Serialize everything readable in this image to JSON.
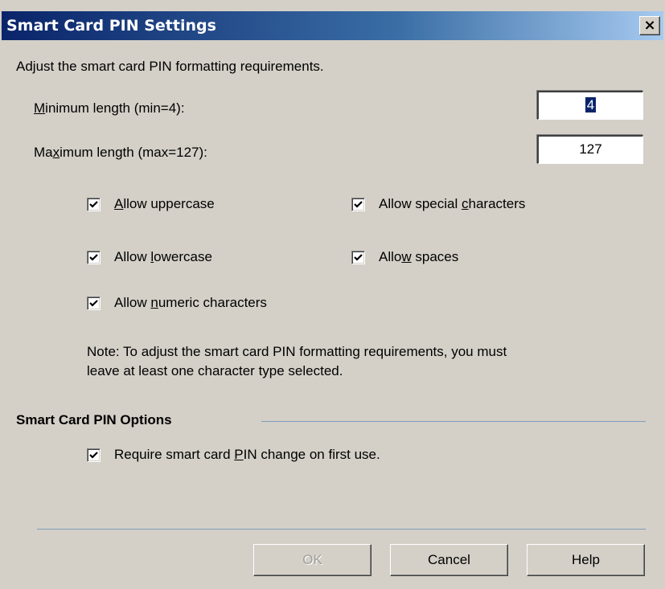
{
  "window": {
    "title": "Smart Card PIN Settings",
    "close_glyph": "×"
  },
  "intro_text": "Adjust the smart card PIN formatting requirements.",
  "min_length": {
    "label_accel": "M",
    "label_rest": "inimum length (min=4):",
    "value": "4"
  },
  "max_length": {
    "label_pre": "Ma",
    "label_accel": "x",
    "label_rest": "imum length (max=127):",
    "value": "127"
  },
  "checkboxes": {
    "uppercase": {
      "pre": "",
      "accel": "A",
      "rest": "llow uppercase",
      "checked": true
    },
    "lowercase": {
      "pre": "Allow ",
      "accel": "l",
      "rest": "owercase",
      "checked": true
    },
    "numeric": {
      "pre": "Allow ",
      "accel": "n",
      "rest": "umeric characters",
      "checked": true
    },
    "special": {
      "pre": "Allow special ",
      "accel": "c",
      "rest": "haracters",
      "checked": true
    },
    "spaces": {
      "pre": "Allo",
      "accel": "w",
      "rest": " spaces",
      "checked": true
    }
  },
  "note_line1": "Note: To adjust the smart card PIN formatting requirements, you must",
  "note_line2": "leave at least one character type selected.",
  "options_group": {
    "title": "Smart Card PIN Options",
    "require_change": {
      "pre": "Require smart card ",
      "accel": "P",
      "rest": "IN change on first use.",
      "checked": true
    }
  },
  "buttons": {
    "ok": "OK",
    "cancel": "Cancel",
    "help": "Help"
  }
}
